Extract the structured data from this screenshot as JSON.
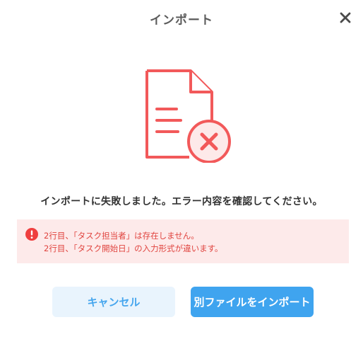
{
  "dialog": {
    "title": "インポート",
    "close_icon": "close-icon",
    "illustration_icon": "document-error-icon",
    "message": "インポートに失敗しました。エラー内容を確認してください。",
    "errors": [
      "2行目、「タスク担当者」は存在しません。",
      "2行目、「タスク開始日」の入力形式が違います。"
    ],
    "buttons": {
      "cancel_label": "キャンセル",
      "import_label": "別ファイルをインポート"
    }
  },
  "colors": {
    "accent": "#3fa4ef",
    "error": "#f2595a",
    "error_bg": "#fdeaea",
    "title": "#5b5b5b"
  }
}
